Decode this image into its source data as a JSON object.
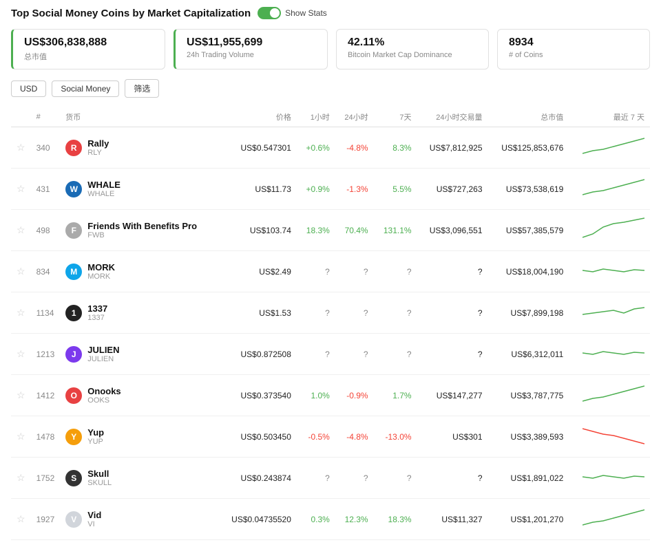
{
  "header": {
    "title": "Top Social Money Coins by Market Capitalization",
    "show_stats_label": "Show Stats"
  },
  "stats": [
    {
      "value": "US$306,838,888",
      "label": "总市值",
      "accent": true
    },
    {
      "value": "US$11,955,699",
      "label": "24h Trading Volume",
      "accent": true
    },
    {
      "value": "42.11%",
      "label": "Bitcoin Market Cap Dominance",
      "accent": false
    },
    {
      "value": "8934",
      "label": "# of Coins",
      "accent": false
    }
  ],
  "filters": [
    "USD",
    "Social Money",
    "筛选"
  ],
  "table": {
    "columns": [
      "#",
      "货币",
      "",
      "价格",
      "1小时",
      "24小时",
      "7天",
      "24小时交易量",
      "总市值",
      "最近 7 天"
    ],
    "rows": [
      {
        "rank": "340",
        "name": "Rally",
        "symbol": "RLY",
        "icon_color": "#e84142",
        "icon_text": "R",
        "price": "US$0.547301",
        "h1": "+0.6%",
        "h1_class": "pos",
        "h24": "-4.8%",
        "h24_class": "neg",
        "d7": "8.3%",
        "d7_class": "pos",
        "vol24": "US$7,812,925",
        "mcap": "US$125,853,676",
        "spark": "up"
      },
      {
        "rank": "431",
        "name": "WHALE",
        "symbol": "WHALE",
        "icon_color": "#1a6bb5",
        "icon_text": "W",
        "price": "US$11.73",
        "h1": "+0.9%",
        "h1_class": "pos",
        "h24": "-1.3%",
        "h24_class": "neg",
        "d7": "5.5%",
        "d7_class": "pos",
        "vol24": "US$727,263",
        "mcap": "US$73,538,619",
        "spark": "up"
      },
      {
        "rank": "498",
        "name": "Friends With Benefits Pro",
        "symbol": "FWB",
        "icon_color": "#aaa",
        "icon_text": "F",
        "price": "US$103.74",
        "h1": "18.3%",
        "h1_class": "pos",
        "h24": "70.4%",
        "h24_class": "pos",
        "d7": "131.1%",
        "d7_class": "pos",
        "vol24": "US$3,096,551",
        "mcap": "US$57,385,579",
        "spark": "up_high"
      },
      {
        "rank": "834",
        "name": "MORK",
        "symbol": "MORK",
        "icon_color": "#0ea5e9",
        "icon_text": "M",
        "price": "US$2.49",
        "h1": "?",
        "h1_class": "neutral",
        "h24": "?",
        "h24_class": "neutral",
        "d7": "?",
        "d7_class": "neutral",
        "vol24": "?",
        "mcap": "US$18,004,190",
        "spark": "flat"
      },
      {
        "rank": "1134",
        "name": "1337",
        "symbol": "1337",
        "icon_color": "#222",
        "icon_text": "1",
        "price": "US$1.53",
        "h1": "?",
        "h1_class": "neutral",
        "h24": "?",
        "h24_class": "neutral",
        "d7": "?",
        "d7_class": "neutral",
        "vol24": "?",
        "mcap": "US$7,899,198",
        "spark": "up_slight"
      },
      {
        "rank": "1213",
        "name": "JULIEN",
        "symbol": "JULIEN",
        "icon_color": "#7c3aed",
        "icon_text": "J",
        "price": "US$0.872508",
        "h1": "?",
        "h1_class": "neutral",
        "h24": "?",
        "h24_class": "neutral",
        "d7": "?",
        "d7_class": "neutral",
        "vol24": "?",
        "mcap": "US$6,312,011",
        "spark": "flat"
      },
      {
        "rank": "1412",
        "name": "Onooks",
        "symbol": "OOKS",
        "icon_color": "#e84142",
        "icon_text": "O",
        "price": "US$0.373540",
        "h1": "1.0%",
        "h1_class": "pos",
        "h24": "-0.9%",
        "h24_class": "neg",
        "d7": "1.7%",
        "d7_class": "pos",
        "vol24": "US$147,277",
        "mcap": "US$3,787,775",
        "spark": "up"
      },
      {
        "rank": "1478",
        "name": "Yup",
        "symbol": "YUP",
        "icon_color": "#f59e0b",
        "icon_text": "Y",
        "price": "US$0.503450",
        "h1": "-0.5%",
        "h1_class": "neg",
        "h24": "-4.8%",
        "h24_class": "neg",
        "d7": "-13.0%",
        "d7_class": "neg",
        "vol24": "US$301",
        "mcap": "US$3,389,593",
        "spark": "down"
      },
      {
        "rank": "1752",
        "name": "Skull",
        "symbol": "SKULL",
        "icon_color": "#333",
        "icon_text": "S",
        "price": "US$0.243874",
        "h1": "?",
        "h1_class": "neutral",
        "h24": "?",
        "h24_class": "neutral",
        "d7": "?",
        "d7_class": "neutral",
        "vol24": "?",
        "mcap": "US$1,891,022",
        "spark": "flat"
      },
      {
        "rank": "1927",
        "name": "Vid",
        "symbol": "VI",
        "icon_color": "#d1d5db",
        "icon_text": "V",
        "price": "US$0.04735520",
        "h1": "0.3%",
        "h1_class": "pos",
        "h24": "12.3%",
        "h24_class": "pos",
        "d7": "18.3%",
        "d7_class": "pos",
        "vol24": "US$11,327",
        "mcap": "US$1,201,270",
        "spark": "up"
      }
    ]
  }
}
